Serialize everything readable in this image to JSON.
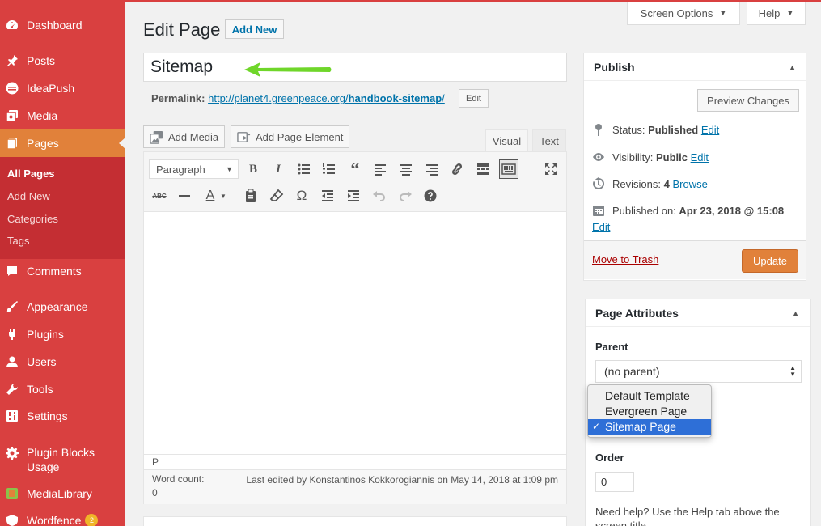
{
  "sidebar": {
    "items": [
      {
        "label": "Dashboard",
        "icon": "dashboard-icon"
      },
      {
        "label": "Posts",
        "icon": "pin-icon"
      },
      {
        "label": "IdeaPush",
        "icon": "idea-icon"
      },
      {
        "label": "Media",
        "icon": "media-icon"
      },
      {
        "label": "Pages",
        "icon": "pages-icon"
      },
      {
        "label": "Comments",
        "icon": "comment-icon"
      },
      {
        "label": "Appearance",
        "icon": "brush-icon"
      },
      {
        "label": "Plugins",
        "icon": "plug-icon"
      },
      {
        "label": "Users",
        "icon": "user-icon"
      },
      {
        "label": "Tools",
        "icon": "wrench-icon"
      },
      {
        "label": "Settings",
        "icon": "settings-icon"
      },
      {
        "label": "Plugin Blocks Usage",
        "icon": "gear-icon"
      },
      {
        "label": "MediaLibrary",
        "icon": "library-icon"
      },
      {
        "label": "Wordfence",
        "icon": "wordfence-icon",
        "badge": "2"
      }
    ],
    "submenu": [
      "All Pages",
      "Add New",
      "Categories",
      "Tags"
    ],
    "plugin_label_line1": "Plugin Blocks",
    "plugin_label_line2": "Usage"
  },
  "topbar": {
    "screen_options": "Screen Options",
    "help": "Help"
  },
  "header": {
    "title": "Edit Page",
    "add_new": "Add New"
  },
  "post": {
    "title": "Sitemap",
    "permalink_label": "Permalink:",
    "permalink_base": "http://planet4.greenpeace.org/",
    "permalink_slug": "handbook-sitemap",
    "permalink_tail": "/",
    "permalink_edit": "Edit"
  },
  "media_buttons": {
    "add_media": "Add Media",
    "add_page_element": "Add Page Element"
  },
  "editor": {
    "tab_visual": "Visual",
    "tab_text": "Text",
    "format": "Paragraph",
    "path": "P",
    "word_count_label": "Word count:",
    "word_count": "0",
    "last_edited": "Last edited by Konstantinos Kokkorogiannis on May 14, 2018 at 1:09 pm"
  },
  "publish": {
    "title": "Publish",
    "preview": "Preview Changes",
    "status_label": "Status:",
    "status_value": "Published",
    "visibility_label": "Visibility:",
    "visibility_value": "Public",
    "revisions_label": "Revisions:",
    "revisions_value": "4",
    "browse": "Browse",
    "published_on_label": "Published on:",
    "published_on_value": "Apr 23, 2018 @ 15:08",
    "edit": "Edit",
    "trash": "Move to Trash",
    "update": "Update"
  },
  "page_attributes": {
    "title": "Page Attributes",
    "parent_label": "Parent",
    "parent_value": "(no parent)",
    "template_options": [
      "Default Template",
      "Evergreen Page",
      "Sitemap Page"
    ],
    "template_selected": 2,
    "order_label": "Order",
    "order_value": "0",
    "help": "Need help? Use the Help tab above the screen title."
  },
  "colors": {
    "sidebar": "#d94040",
    "current": "#e1813a",
    "link": "#0073aa",
    "update": "#e1813a",
    "arrow": "#6fd62a"
  }
}
